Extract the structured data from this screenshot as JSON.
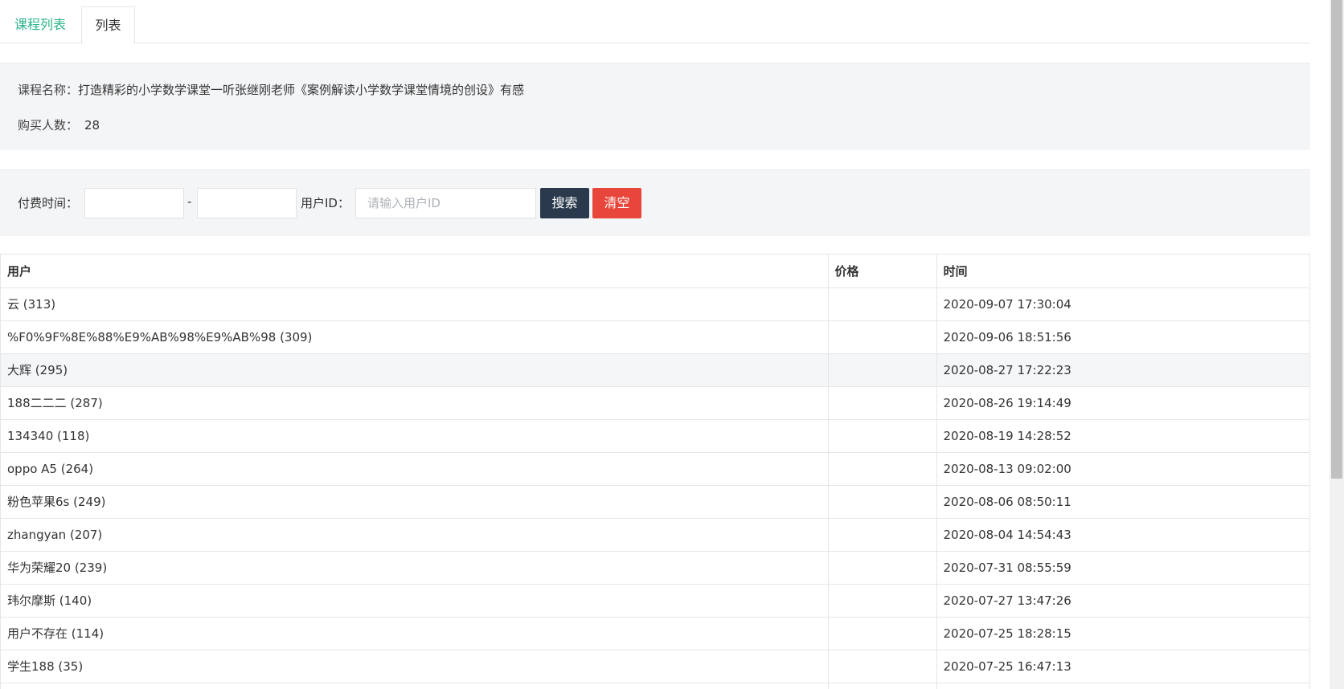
{
  "tabs": [
    {
      "label": "课程列表",
      "active": false
    },
    {
      "label": "列表",
      "active": true
    }
  ],
  "info": {
    "course_label": "课程名称：",
    "course_name": "打造精彩的小学数学课堂一听张继刚老师《案例解读小学数学课堂情境的创设》有感",
    "buyers_label": "购买人数：",
    "buyers_count": "28"
  },
  "filter": {
    "pay_time_label": "付费时间：",
    "date_separator": "-",
    "start_date": "",
    "end_date": "",
    "user_id_label": "用户ID：",
    "user_id_placeholder": "请输入用户ID",
    "search_label": "搜索",
    "clear_label": "清空"
  },
  "table": {
    "columns": [
      "用户",
      "价格",
      "时间"
    ],
    "rows": [
      {
        "user": "云 (313)",
        "price": "",
        "time": "2020-09-07 17:30:04"
      },
      {
        "user": "%F0%9F%8E%88%E9%AB%98%E9%AB%98 (309)",
        "price": "",
        "time": "2020-09-06 18:51:56"
      },
      {
        "user": "大辉 (295)",
        "price": "",
        "time": "2020-08-27 17:22:23"
      },
      {
        "user": "188二二二 (287)",
        "price": "",
        "time": "2020-08-26 19:14:49"
      },
      {
        "user": "134340 (118)",
        "price": "",
        "time": "2020-08-19 14:28:52"
      },
      {
        "user": "oppo A5 (264)",
        "price": "",
        "time": "2020-08-13 09:02:00"
      },
      {
        "user": "粉色苹果6s (249)",
        "price": "",
        "time": "2020-08-06 08:50:11"
      },
      {
        "user": "zhangyan (207)",
        "price": "",
        "time": "2020-08-04 14:54:43"
      },
      {
        "user": "华为荣耀20 (239)",
        "price": "",
        "time": "2020-07-31 08:55:59"
      },
      {
        "user": "玮尔摩斯 (140)",
        "price": "",
        "time": "2020-07-27 13:47:26"
      },
      {
        "user": "用户不存在 (114)",
        "price": "",
        "time": "2020-07-25 18:28:15"
      },
      {
        "user": "学生188 (35)",
        "price": "",
        "time": "2020-07-25 16:47:13"
      },
      {
        "user": "",
        "price": "",
        "time": ""
      }
    ]
  },
  "colors": {
    "tab_active_text": "#2bb38a",
    "search_button": "#2a3a4c",
    "clear_button": "#e8463a",
    "panel_bg": "#f4f5f7"
  }
}
